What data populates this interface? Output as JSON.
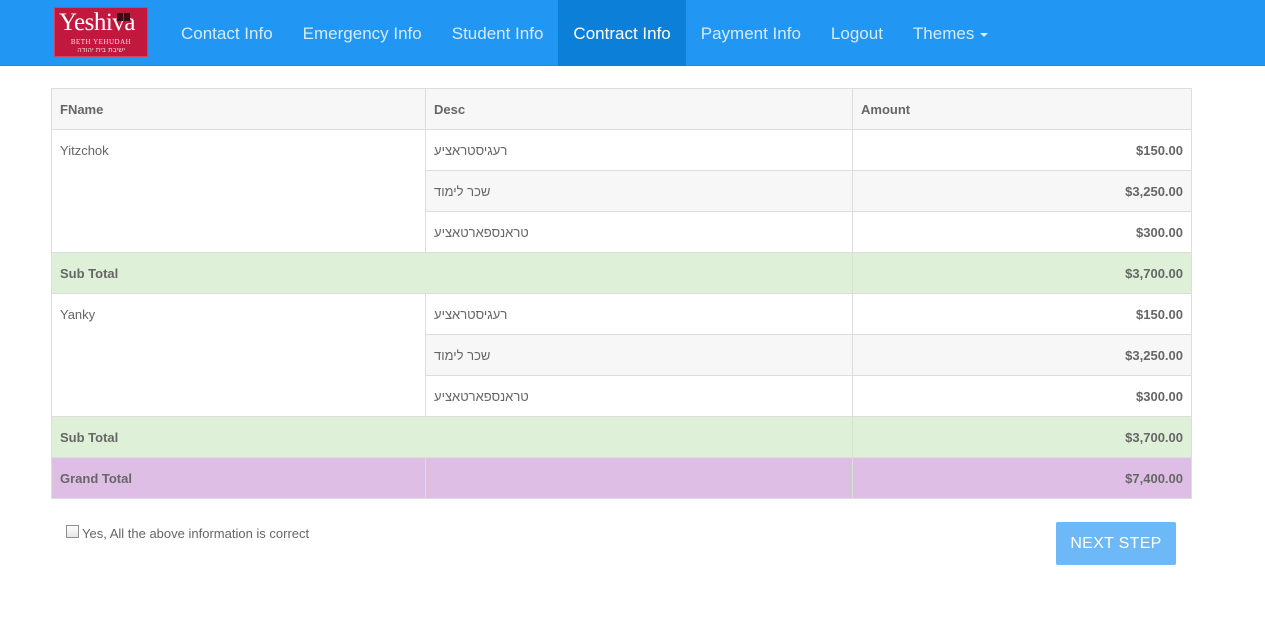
{
  "brand": {
    "name": "Yeshiva",
    "subtitle": "BETH YEHUDAH",
    "hebrew": "ישיבת בית יהודה"
  },
  "nav": {
    "items": [
      {
        "label": "Contact Info"
      },
      {
        "label": "Emergency Info"
      },
      {
        "label": "Student Info"
      },
      {
        "label": "Contract Info",
        "active": true
      },
      {
        "label": "Payment Info"
      },
      {
        "label": "Logout"
      },
      {
        "label": "Themes",
        "dropdown": true
      }
    ]
  },
  "table": {
    "headers": [
      "FName",
      "Desc",
      "Amount"
    ],
    "students": [
      {
        "name": "Yitzchok",
        "rows": [
          {
            "desc": "רעגיסטראציע",
            "amount": "$150.00"
          },
          {
            "desc": "שכר לימוד",
            "amount": "$3,250.00"
          },
          {
            "desc": "טראנספארטאציע",
            "amount": "$300.00"
          }
        ],
        "subtotal_label": "Sub Total",
        "subtotal": "$3,700.00"
      },
      {
        "name": "Yanky",
        "rows": [
          {
            "desc": "רעגיסטראציע",
            "amount": "$150.00"
          },
          {
            "desc": "שכר לימוד",
            "amount": "$3,250.00"
          },
          {
            "desc": "טראנספארטאציע",
            "amount": "$300.00"
          }
        ],
        "subtotal_label": "Sub Total",
        "subtotal": "$3,700.00"
      }
    ],
    "grand_total_label": "Grand Total",
    "grand_total": "$7,400.00"
  },
  "confirm": {
    "label": "Yes, All the above information is correct",
    "checked": false
  },
  "next_button": {
    "label": "NEXT STEP"
  },
  "colors": {
    "navbar": "#2196f3",
    "nav_active": "#0c7fd9",
    "brand": "#c2183d",
    "subtotal_row": "#dff0d8",
    "grand_total_row": "#dfbee6",
    "next_button": "#6db8f7"
  }
}
